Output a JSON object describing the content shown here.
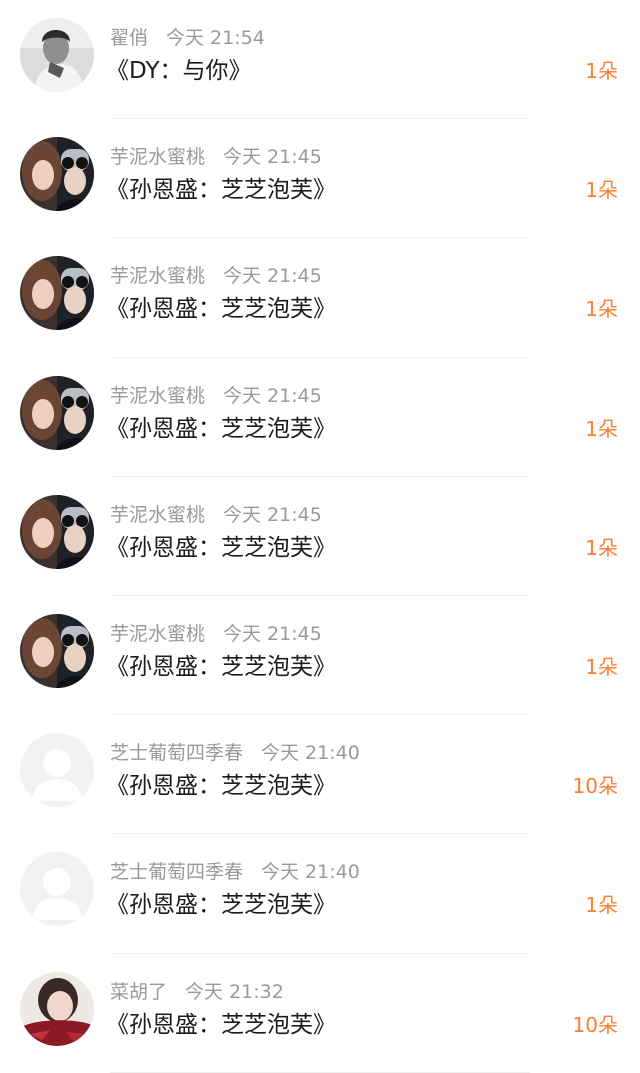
{
  "colors": {
    "count_accent": "#ff7e2e",
    "meta_text": "#9a9a9a",
    "message_text": "#1c1c1c",
    "divider": "#efefef"
  },
  "messages": [
    {
      "name": "翟俏",
      "time": "今天 21:54",
      "text": "《DY：与你》",
      "count": "1朵",
      "avatar": "mono-portrait"
    },
    {
      "name": "芋泥水蜜桃",
      "time": "今天 21:45",
      "text": "《孙恩盛：芝芝泡芙》",
      "count": "1朵",
      "avatar": "couple-photo"
    },
    {
      "name": "芋泥水蜜桃",
      "time": "今天 21:45",
      "text": "《孙恩盛：芝芝泡芙》",
      "count": "1朵",
      "avatar": "couple-photo"
    },
    {
      "name": "芋泥水蜜桃",
      "time": "今天 21:45",
      "text": "《孙恩盛：芝芝泡芙》",
      "count": "1朵",
      "avatar": "couple-photo"
    },
    {
      "name": "芋泥水蜜桃",
      "time": "今天 21:45",
      "text": "《孙恩盛：芝芝泡芙》",
      "count": "1朵",
      "avatar": "couple-photo"
    },
    {
      "name": "芋泥水蜜桃",
      "time": "今天 21:45",
      "text": "《孙恩盛：芝芝泡芙》",
      "count": "1朵",
      "avatar": "couple-photo"
    },
    {
      "name": "芝士葡萄四季春",
      "time": "今天 21:40",
      "text": "《孙恩盛：芝芝泡芙》",
      "count": "10朵",
      "avatar": "default-user"
    },
    {
      "name": "芝士葡萄四季春",
      "time": "今天 21:40",
      "text": "《孙恩盛：芝芝泡芙》",
      "count": "1朵",
      "avatar": "default-user"
    },
    {
      "name": "菜胡了",
      "time": "今天 21:32",
      "text": "《孙恩盛：芝芝泡芙》",
      "count": "10朵",
      "avatar": "red-portrait"
    }
  ]
}
